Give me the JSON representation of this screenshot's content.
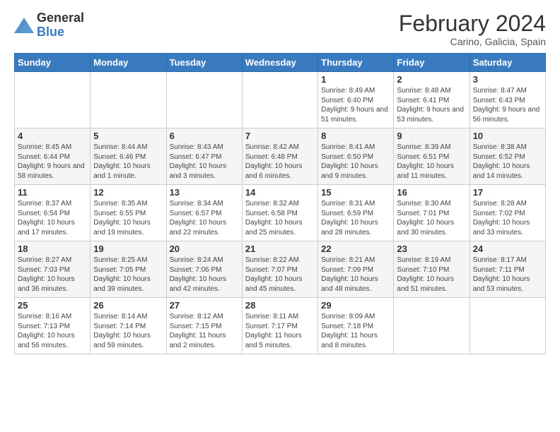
{
  "logo": {
    "general": "General",
    "blue": "Blue"
  },
  "header": {
    "month": "February 2024",
    "location": "Carino, Galicia, Spain"
  },
  "weekdays": [
    "Sunday",
    "Monday",
    "Tuesday",
    "Wednesday",
    "Thursday",
    "Friday",
    "Saturday"
  ],
  "weeks": [
    [
      {
        "day": "",
        "info": ""
      },
      {
        "day": "",
        "info": ""
      },
      {
        "day": "",
        "info": ""
      },
      {
        "day": "",
        "info": ""
      },
      {
        "day": "1",
        "info": "Sunrise: 8:49 AM\nSunset: 6:40 PM\nDaylight: 9 hours\nand 51 minutes."
      },
      {
        "day": "2",
        "info": "Sunrise: 8:48 AM\nSunset: 6:41 PM\nDaylight: 9 hours\nand 53 minutes."
      },
      {
        "day": "3",
        "info": "Sunrise: 8:47 AM\nSunset: 6:43 PM\nDaylight: 9 hours\nand 56 minutes."
      }
    ],
    [
      {
        "day": "4",
        "info": "Sunrise: 8:45 AM\nSunset: 6:44 PM\nDaylight: 9 hours\nand 58 minutes."
      },
      {
        "day": "5",
        "info": "Sunrise: 8:44 AM\nSunset: 6:46 PM\nDaylight: 10 hours\nand 1 minute."
      },
      {
        "day": "6",
        "info": "Sunrise: 8:43 AM\nSunset: 6:47 PM\nDaylight: 10 hours\nand 3 minutes."
      },
      {
        "day": "7",
        "info": "Sunrise: 8:42 AM\nSunset: 6:48 PM\nDaylight: 10 hours\nand 6 minutes."
      },
      {
        "day": "8",
        "info": "Sunrise: 8:41 AM\nSunset: 6:50 PM\nDaylight: 10 hours\nand 9 minutes."
      },
      {
        "day": "9",
        "info": "Sunrise: 8:39 AM\nSunset: 6:51 PM\nDaylight: 10 hours\nand 11 minutes."
      },
      {
        "day": "10",
        "info": "Sunrise: 8:38 AM\nSunset: 6:52 PM\nDaylight: 10 hours\nand 14 minutes."
      }
    ],
    [
      {
        "day": "11",
        "info": "Sunrise: 8:37 AM\nSunset: 6:54 PM\nDaylight: 10 hours\nand 17 minutes."
      },
      {
        "day": "12",
        "info": "Sunrise: 8:35 AM\nSunset: 6:55 PM\nDaylight: 10 hours\nand 19 minutes."
      },
      {
        "day": "13",
        "info": "Sunrise: 8:34 AM\nSunset: 6:57 PM\nDaylight: 10 hours\nand 22 minutes."
      },
      {
        "day": "14",
        "info": "Sunrise: 8:32 AM\nSunset: 6:58 PM\nDaylight: 10 hours\nand 25 minutes."
      },
      {
        "day": "15",
        "info": "Sunrise: 8:31 AM\nSunset: 6:59 PM\nDaylight: 10 hours\nand 28 minutes."
      },
      {
        "day": "16",
        "info": "Sunrise: 8:30 AM\nSunset: 7:01 PM\nDaylight: 10 hours\nand 30 minutes."
      },
      {
        "day": "17",
        "info": "Sunrise: 8:28 AM\nSunset: 7:02 PM\nDaylight: 10 hours\nand 33 minutes."
      }
    ],
    [
      {
        "day": "18",
        "info": "Sunrise: 8:27 AM\nSunset: 7:03 PM\nDaylight: 10 hours\nand 36 minutes."
      },
      {
        "day": "19",
        "info": "Sunrise: 8:25 AM\nSunset: 7:05 PM\nDaylight: 10 hours\nand 39 minutes."
      },
      {
        "day": "20",
        "info": "Sunrise: 8:24 AM\nSunset: 7:06 PM\nDaylight: 10 hours\nand 42 minutes."
      },
      {
        "day": "21",
        "info": "Sunrise: 8:22 AM\nSunset: 7:07 PM\nDaylight: 10 hours\nand 45 minutes."
      },
      {
        "day": "22",
        "info": "Sunrise: 8:21 AM\nSunset: 7:09 PM\nDaylight: 10 hours\nand 48 minutes."
      },
      {
        "day": "23",
        "info": "Sunrise: 8:19 AM\nSunset: 7:10 PM\nDaylight: 10 hours\nand 51 minutes."
      },
      {
        "day": "24",
        "info": "Sunrise: 8:17 AM\nSunset: 7:11 PM\nDaylight: 10 hours\nand 53 minutes."
      }
    ],
    [
      {
        "day": "25",
        "info": "Sunrise: 8:16 AM\nSunset: 7:13 PM\nDaylight: 10 hours\nand 56 minutes."
      },
      {
        "day": "26",
        "info": "Sunrise: 8:14 AM\nSunset: 7:14 PM\nDaylight: 10 hours\nand 59 minutes."
      },
      {
        "day": "27",
        "info": "Sunrise: 8:12 AM\nSunset: 7:15 PM\nDaylight: 11 hours\nand 2 minutes."
      },
      {
        "day": "28",
        "info": "Sunrise: 8:11 AM\nSunset: 7:17 PM\nDaylight: 11 hours\nand 5 minutes."
      },
      {
        "day": "29",
        "info": "Sunrise: 8:09 AM\nSunset: 7:18 PM\nDaylight: 11 hours\nand 8 minutes."
      },
      {
        "day": "",
        "info": ""
      },
      {
        "day": "",
        "info": ""
      }
    ]
  ]
}
